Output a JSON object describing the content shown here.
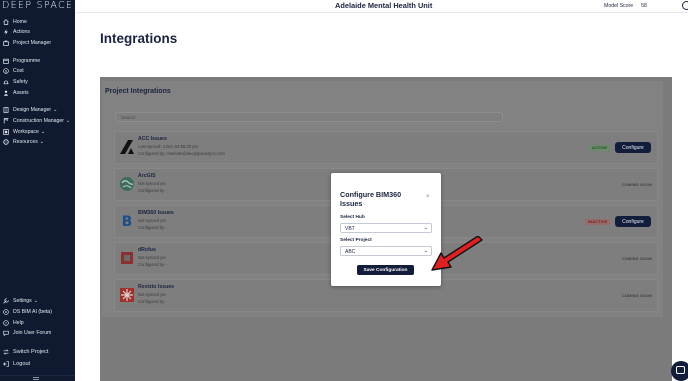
{
  "brand": {
    "logo_text": "DEEP SPACE"
  },
  "sidebar": {
    "group1": [
      {
        "label": "Home",
        "icon": "home-icon"
      },
      {
        "label": "Actions",
        "icon": "bolt-icon"
      },
      {
        "label": "Project Manager",
        "icon": "briefcase-icon"
      }
    ],
    "group2": [
      {
        "label": "Programme",
        "icon": "calendar-icon"
      },
      {
        "label": "Cost",
        "icon": "dollar-icon"
      },
      {
        "label": "Safety",
        "icon": "safety-icon"
      },
      {
        "label": "Assets",
        "icon": "person-icon"
      }
    ],
    "group3": [
      {
        "label": "Design Manager",
        "icon": "building-icon"
      },
      {
        "label": "Construction Manager",
        "icon": "crane-icon"
      },
      {
        "label": "Workspace",
        "icon": "workspace-icon"
      },
      {
        "label": "Resources",
        "icon": "globe-icon"
      }
    ],
    "bottom": [
      {
        "label": "Settings",
        "icon": "wrench-icon"
      },
      {
        "label": "DS BIM AI (beta)",
        "icon": "ai-icon"
      },
      {
        "label": "Help",
        "icon": "help-icon"
      },
      {
        "label": "Join User Forum",
        "icon": "chat-icon"
      },
      {
        "label": "Switch Project",
        "icon": "switch-icon"
      },
      {
        "label": "Logout",
        "icon": "logout-icon"
      }
    ]
  },
  "topbar": {
    "title": "Adelaide Mental Health Unit",
    "model_score_label": "Model Score",
    "model_score_value": "58"
  },
  "page": {
    "title": "Integrations",
    "section_title": "Project Integrations",
    "search_placeholder": "Search"
  },
  "integrations": [
    {
      "name": "ACC Issues",
      "line1": "Last synced: 4 Dec 04:55:30 pm",
      "line2": "Configured by: charlotte@deepspacesync.com",
      "status": "ACTIVE",
      "button": "Configure"
    },
    {
      "name": "ArcGIS",
      "line1": "Not synced yet",
      "line2": "Configured by -",
      "status": "COMING SOON"
    },
    {
      "name": "BIM360 Issues",
      "line1": "Not synced yet",
      "line2": "Configured by -",
      "status": "INACTIVE",
      "button": "Configure"
    },
    {
      "name": "dRofus",
      "line1": "Not synced yet",
      "line2": "Configured by -",
      "status": "COMING SOON"
    },
    {
      "name": "Revizto Issues",
      "line1": "Not synced yet",
      "line2": "Configured by -",
      "status": "COMING SOON"
    }
  ],
  "modal": {
    "title": "Configure BIM360 Issues",
    "close": "×",
    "hub_label": "Select Hub",
    "hub_value": "VBT",
    "project_label": "Select Project",
    "project_value": "ABC",
    "save_label": "Save Configuration"
  },
  "colors": {
    "navy": "#121d3b",
    "sidebar": "#0f1a30",
    "arrow_red": "#e02020"
  }
}
